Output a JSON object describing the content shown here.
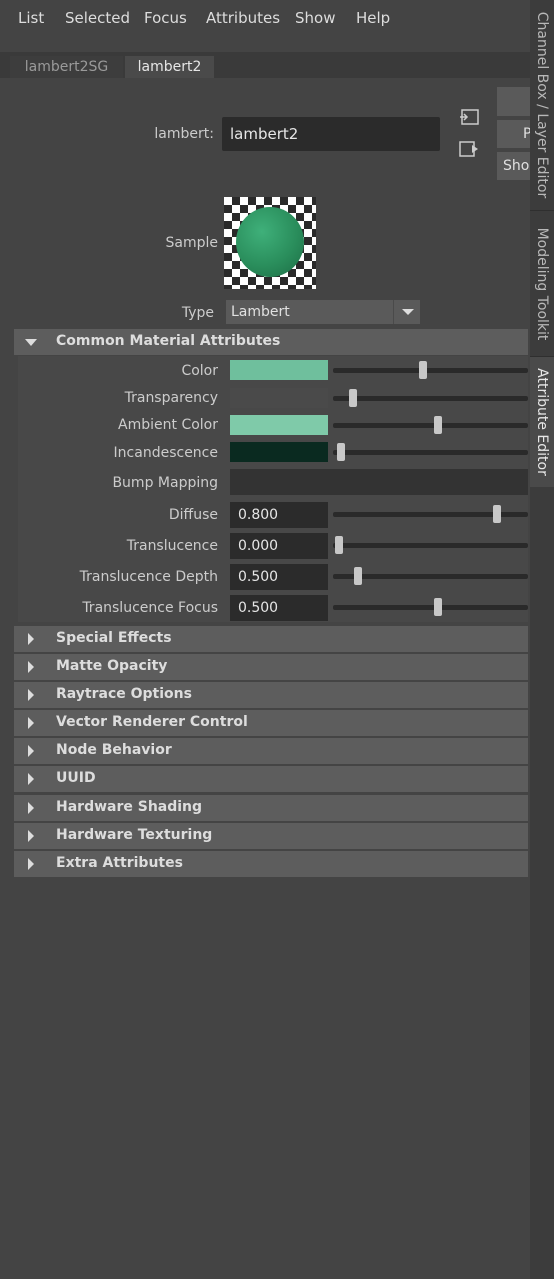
{
  "menu": [
    "List",
    "Selected",
    "Focus",
    "Attributes",
    "Show",
    "Help"
  ],
  "tabs": [
    {
      "label": "lambert2SG",
      "active": false
    },
    {
      "label": "lambert2",
      "active": true
    }
  ],
  "right_tabs": [
    "Channel Box / Layer Editor",
    "Modeling Toolkit",
    "Attribute Editor"
  ],
  "node": {
    "type_label": "lambert:",
    "name": "lambert2",
    "side_buttons": [
      "",
      "P",
      "Sho"
    ]
  },
  "sample": {
    "label": "Sample"
  },
  "type": {
    "label": "Type",
    "value": "Lambert"
  },
  "common": {
    "title": "Common Material Attributes",
    "attributes": [
      {
        "label": "Color",
        "kind": "color",
        "swatch": "#6fbf9d",
        "slider": 0.46
      },
      {
        "label": "Transparency",
        "kind": "color",
        "swatch": "#4a4a4a",
        "slider": 0.1
      },
      {
        "label": "Ambient Color",
        "kind": "color",
        "swatch": "#7fcaa9",
        "slider": 0.54
      },
      {
        "label": "Incandescence",
        "kind": "color",
        "swatch": "#0a2a20",
        "slider": 0.04
      },
      {
        "label": "Bump Mapping",
        "kind": "map"
      },
      {
        "label": "Diffuse",
        "kind": "number",
        "value": "0.800",
        "slider": 0.84
      },
      {
        "label": "Translucence",
        "kind": "number",
        "value": "0.000",
        "slider": 0.03
      },
      {
        "label": "Translucence Depth",
        "kind": "number",
        "value": "0.500",
        "slider": 0.13
      },
      {
        "label": "Translucence Focus",
        "kind": "number",
        "value": "0.500",
        "slider": 0.54
      }
    ]
  },
  "sections": [
    "Special Effects",
    "Matte Opacity",
    "Raytrace Options",
    "Vector Renderer Control",
    "Node Behavior",
    "UUID",
    "Hardware Shading",
    "Hardware Texturing",
    "Extra Attributes"
  ],
  "colors": {
    "panel": "#444444",
    "section_header": "#5d5d5d",
    "field": "#2b2b2b",
    "slider_thumb": "#c8c8c8"
  }
}
